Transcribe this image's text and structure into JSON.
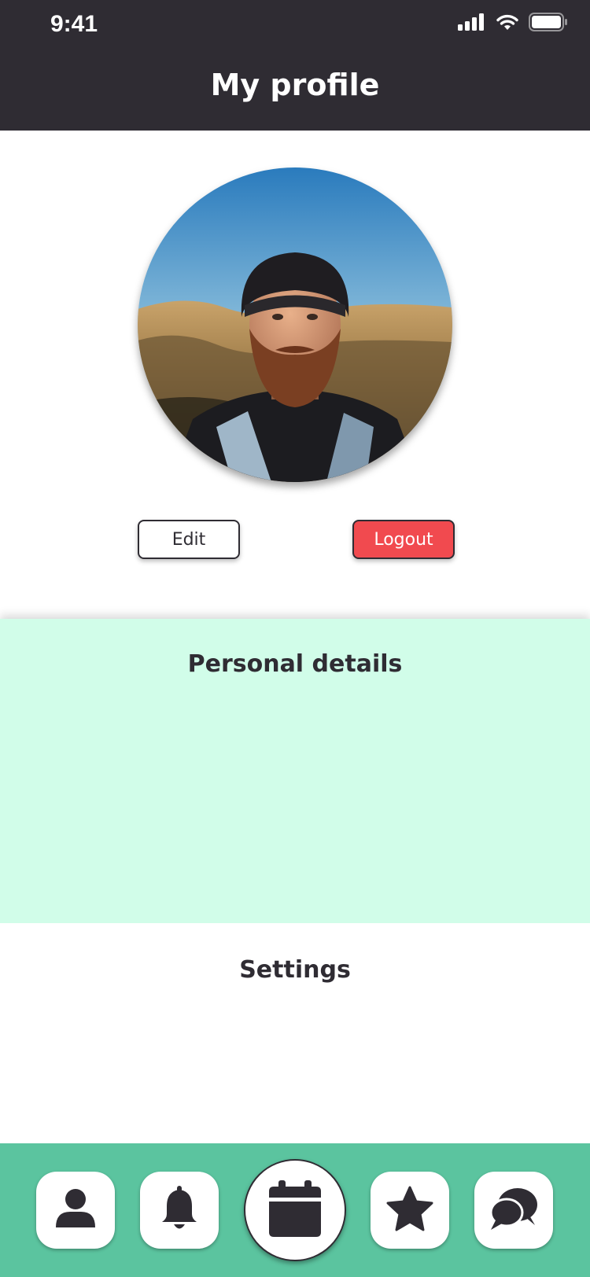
{
  "status_bar": {
    "time": "9:41",
    "icons": [
      "signal-icon",
      "wifi-icon",
      "battery-icon"
    ]
  },
  "header": {
    "title": "My profile"
  },
  "profile": {
    "avatar_alt": "profile photo",
    "edit_label": "Edit",
    "logout_label": "Logout"
  },
  "sections": {
    "personal_title": "Personal details",
    "settings_title": "Settings"
  },
  "bottom_nav": {
    "items": [
      {
        "icon": "user-icon"
      },
      {
        "icon": "bell-icon"
      },
      {
        "icon": "calendar-icon",
        "active": true
      },
      {
        "icon": "star-icon"
      },
      {
        "icon": "chat-icon"
      }
    ]
  },
  "colors": {
    "header_bg": "#2f2c33",
    "logout_bg": "#f14a4f",
    "personal_bg": "#d1fde9",
    "nav_bg": "#5bc49f",
    "icon_color": "#2f2c33"
  }
}
